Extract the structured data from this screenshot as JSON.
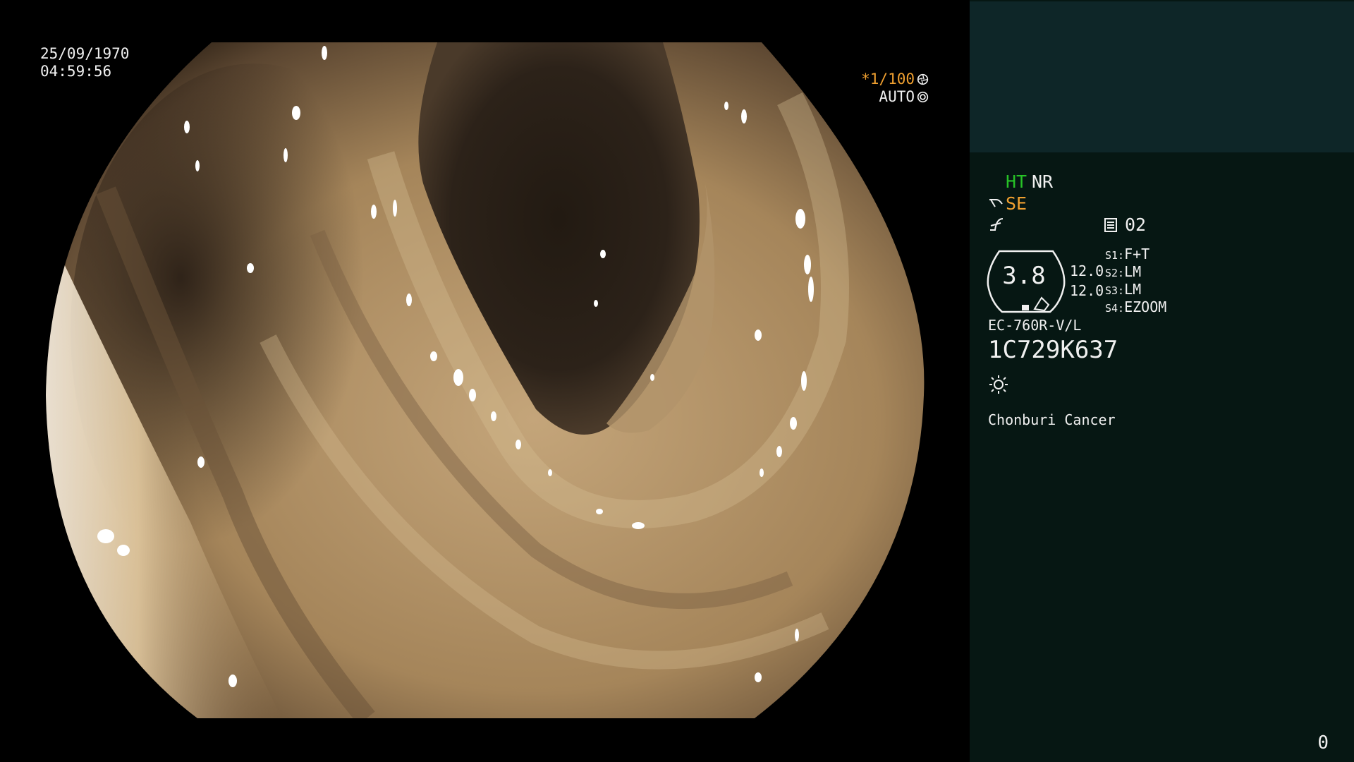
{
  "overlay": {
    "date": "25/09/1970",
    "time": "04:59:56",
    "shutter": "*1/100",
    "exposure_mode": "AUTO",
    "shutter_icon": "aperture-icon",
    "auto_icon": "iris-icon"
  },
  "panel": {
    "ht": "HT",
    "nr": "NR",
    "se": "SE",
    "se_icon": "structure-enhance-icon",
    "curve_icon": "gamma-curve-icon",
    "memory_icon": "memory-card-icon",
    "memory_value": "02",
    "zoom_value": "3.8",
    "param_1": "12.0",
    "param_2": "12.0",
    "switches": [
      {
        "key": "S1:",
        "value": "F+T"
      },
      {
        "key": "S2:",
        "value": "LM"
      },
      {
        "key": "S3:",
        "value": "LM"
      },
      {
        "key": "S4:",
        "value": "EZOOM"
      }
    ],
    "scope_model": "EC-760R-V/L",
    "scope_serial": "1C729K637",
    "light_icon": "light-source-icon",
    "hospital": "Chonburi Cancer",
    "counter": "0"
  },
  "colors": {
    "panel_bg": "#061713",
    "panel_top_bg": "#0e2628",
    "ht_green": "#27c227",
    "amber": "#f0a030",
    "tissue": "#b08e62"
  }
}
